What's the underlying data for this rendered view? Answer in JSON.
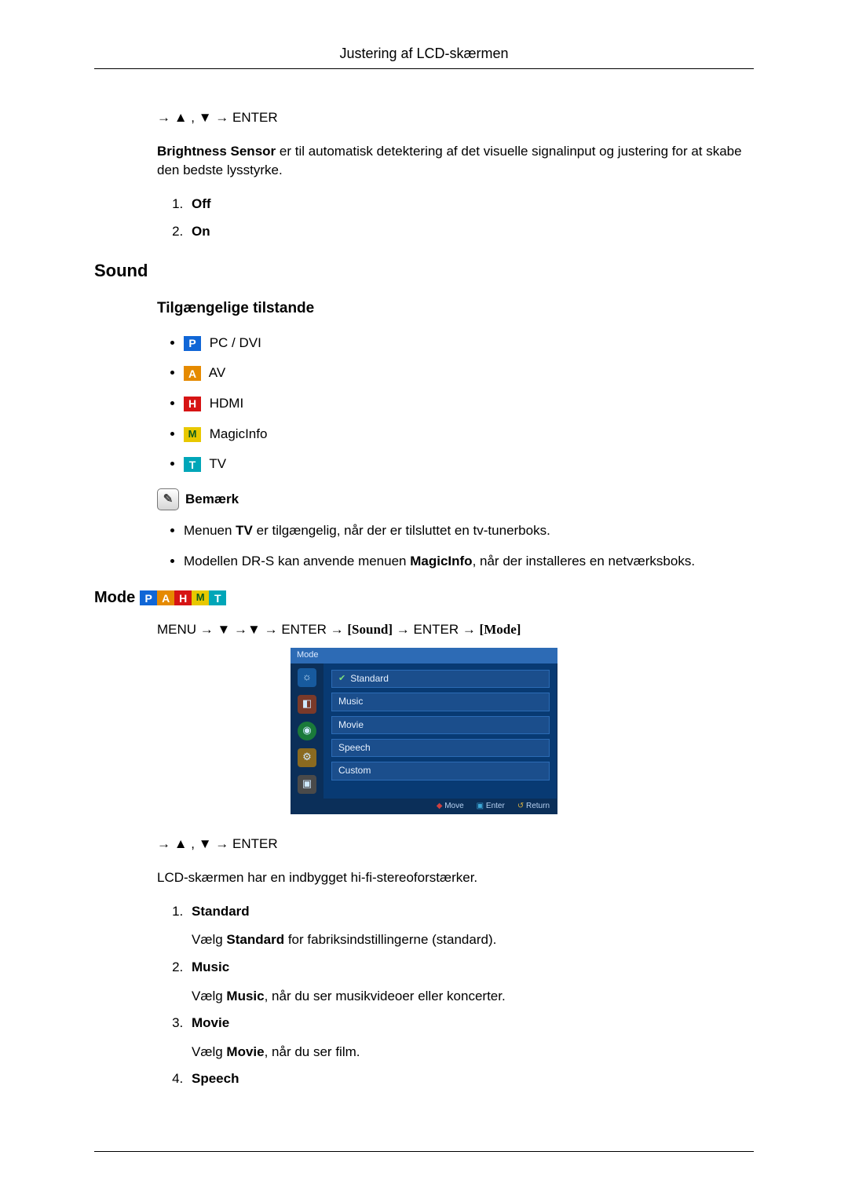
{
  "header": {
    "title": "Justering af LCD-skærmen"
  },
  "brightness": {
    "nav": "→ ▲ , ▼ → ENTER",
    "label": "Brightness Sensor",
    "desc_rest": "  er til automatisk detektering af det visuelle signalinput og justering for at skabe den bedste lysstyrke.",
    "opts": [
      "Off",
      "On"
    ]
  },
  "sound": {
    "heading": "Sound",
    "modes_heading": "Tilgængelige tilstande",
    "modes": [
      {
        "badge": "P",
        "label": " PC / DVI"
      },
      {
        "badge": "A",
        "label": " AV"
      },
      {
        "badge": "H",
        "label": " HDMI"
      },
      {
        "badge": "M",
        "label": " MagicInfo"
      },
      {
        "badge": "T",
        "label": " TV"
      }
    ],
    "note_label": "Bemærk",
    "notes": [
      {
        "pre": "Menuen ",
        "b1": "TV",
        "mid": " er tilgængelig, når der er tilsluttet en tv-tunerboks.",
        "b2": "",
        "post": ""
      },
      {
        "pre": "Modellen DR-S kan anvende menuen ",
        "b1": "MagicInfo",
        "mid": ", når der installeres en netværksboks.",
        "b2": "",
        "post": ""
      }
    ]
  },
  "mode": {
    "heading": "Mode",
    "badges": [
      "P",
      "A",
      "H",
      "M",
      "T"
    ],
    "path_parts": {
      "p1": "MENU → ▼ →▼ → ENTER → ",
      "b1": "[Sound]",
      "p2": " → ENTER → ",
      "b2": "[Mode]"
    },
    "osd": {
      "title": "Mode",
      "options": [
        "Standard",
        "Music",
        "Movie",
        "Speech",
        "Custom"
      ],
      "footer": [
        "Move",
        "Enter",
        "Return"
      ]
    },
    "nav2": "→ ▲ , ▼ → ENTER",
    "intro": "LCD-skærmen har en indbygget hi-fi-stereoforstærker.",
    "items": [
      {
        "title": "Standard",
        "desc_pre": "Vælg ",
        "desc_b": "Standard",
        "desc_post": " for fabriksindstillingerne (standard)."
      },
      {
        "title": "Music",
        "desc_pre": "Vælg ",
        "desc_b": "Music",
        "desc_post": ", når du ser musikvideoer eller koncerter."
      },
      {
        "title": "Movie",
        "desc_pre": "Vælg ",
        "desc_b": "Movie",
        "desc_post": ", når du ser film."
      },
      {
        "title": "Speech",
        "desc_pre": "",
        "desc_b": "",
        "desc_post": ""
      }
    ]
  }
}
